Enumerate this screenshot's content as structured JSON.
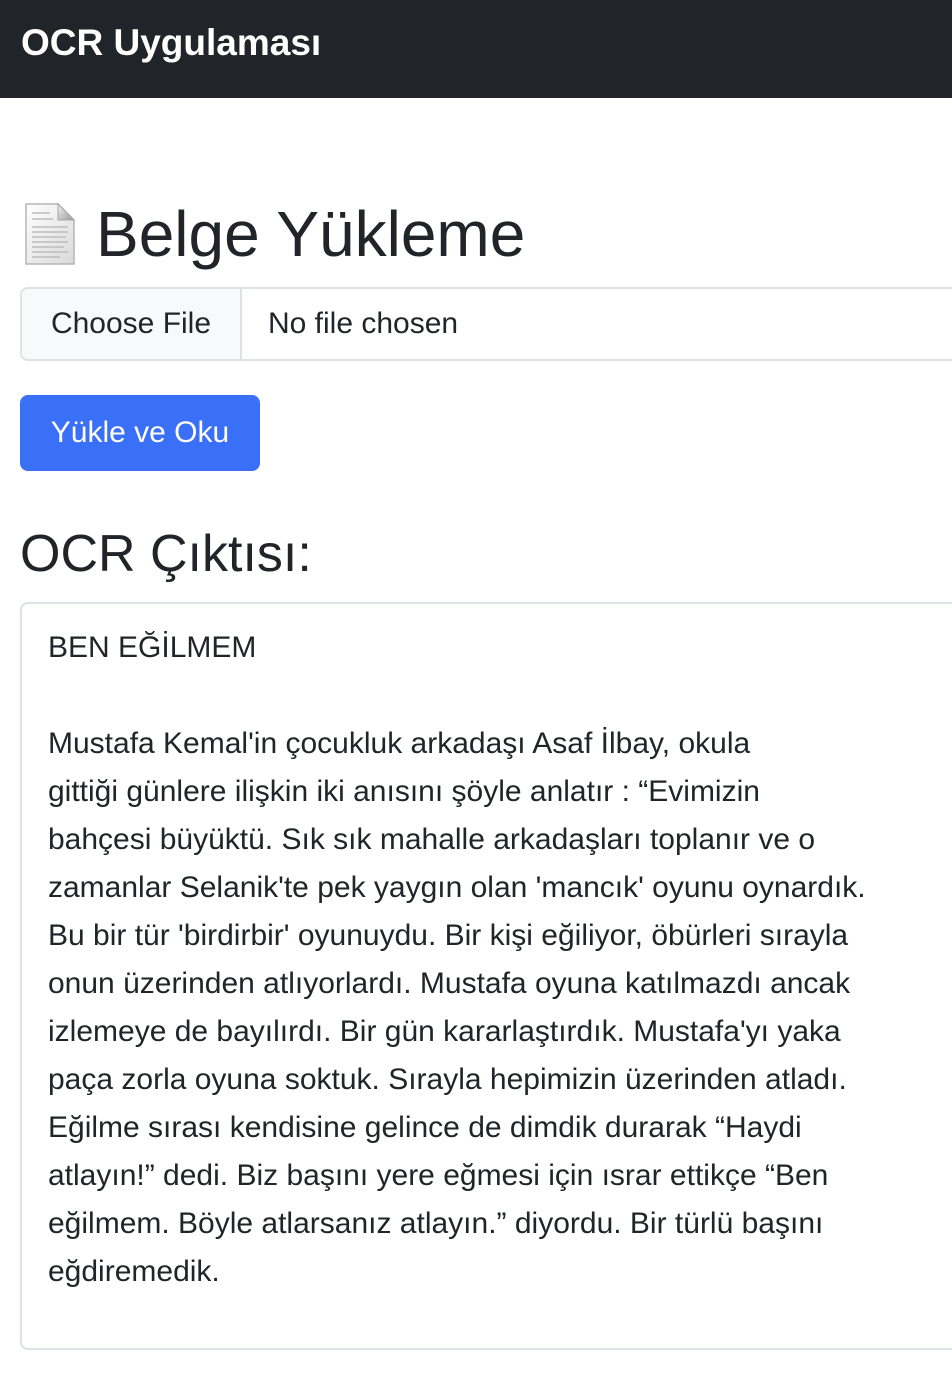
{
  "navbar": {
    "brand": "OCR Uygulaması"
  },
  "upload": {
    "icon": "document-icon",
    "heading": "Belge Yükleme",
    "choose_file_label": "Choose File",
    "file_status": "No file chosen",
    "submit_label": "Yükle ve Oku"
  },
  "output": {
    "heading": "OCR Çıktısı:",
    "title": "BEN EĞİLMEM",
    "lines": [
      "Mustafa Kemal'in çocukluk arkadaşı Asaf İlbay, okula",
      "gittiği günlere ilişkin iki anısını şöyle anlatır : “Evimizin",
      "bahçesi büyüktü. Sık sık mahalle arkadaşları toplanır ve o",
      "zamanlar Selanik'te pek yaygın olan 'mancık' oyunu oynardık.",
      "Bu bir tür 'birdirbir' oyunuydu. Bir kişi eğiliyor, öbürleri sırayla",
      "onun üzerinden atlıyorlardı. Mustafa oyuna katılmazdı ancak",
      "izlemeye de bayılırdı. Bir gün kararlaştırdık. Mustafa'yı yaka",
      "paça zorla oyuna soktuk. Sırayla hepimizin üzerinden atladı.",
      "Eğilme sırası kendisine gelince de dimdik durarak “Haydi",
      "atlayın!” dedi. Biz başını yere eğmesi için ısrar ettikçe “Ben",
      "eğilmem. Böyle atlarsanız atlayın.” diyordu. Bir türlü başını",
      "eğdiremedik."
    ]
  }
}
